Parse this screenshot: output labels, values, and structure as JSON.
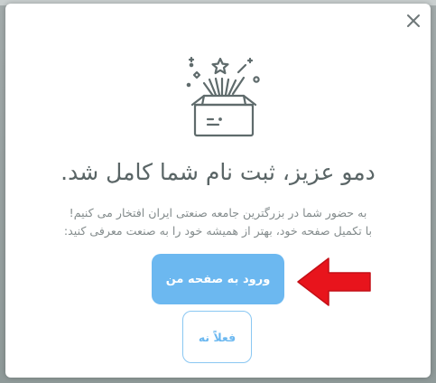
{
  "modal": {
    "close_icon": "close-icon",
    "illustration_icon": "gift-box-fireworks-icon",
    "title": "دمو عزیز، ثبت نام شما کامل شد.",
    "description_line_1": "به حضور شما در بزرگترین جامعه صنعتی ایران افتخار می کنیم!",
    "description_line_2": "با تکمیل صفحه خود، بهتر از همیشه خود را به صنعت معرفی کنید:",
    "primary_button_label": "ورود به صفحه من",
    "secondary_button_label": "فعلاً نه",
    "annotation_arrow_icon": "red-arrow-icon"
  },
  "colors": {
    "primary": "#6cb8f0",
    "title_text": "#5a6566",
    "body_text": "#848c8d",
    "arrow": "#e8141c"
  }
}
